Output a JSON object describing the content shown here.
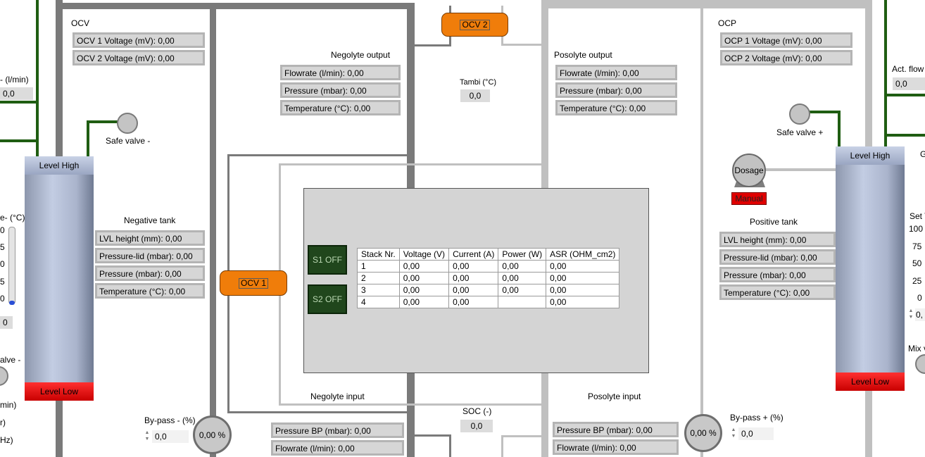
{
  "ocv_panel": {
    "title": "OCV",
    "ocv1": "OCV 1 Voltage (mV): 0,00",
    "ocv2": "OCV 2 Voltage (mV): 0,00"
  },
  "ocp_panel": {
    "title": "OCP",
    "ocp1": "OCP 1 Voltage (mV): 0,00",
    "ocp2": "OCP 2 Voltage (mV): 0,00"
  },
  "negolyte_output": {
    "title": "Negolyte output",
    "flowrate": "Flowrate (l/min): 0,00",
    "pressure": "Pressure (mbar): 0,00",
    "temperature": "Temperature (°C): 0,00"
  },
  "posolyte_output": {
    "title": "Posolyte output",
    "flowrate": "Flowrate (l/min): 0,00",
    "pressure": "Pressure (mbar): 0,00",
    "temperature": "Temperature (°C): 0,00"
  },
  "negative_tank": {
    "title": "Negative tank",
    "lvl": "LVL height (mm): 0,00",
    "pressure_lid": "Pressure-lid (mbar): 0,00",
    "pressure": "Pressure (mbar): 0,00",
    "temperature": "Temperature (°C): 0,00",
    "level_high": "Level High",
    "level_low": "Level Low"
  },
  "positive_tank": {
    "title": "Positive tank",
    "lvl": "LVL height (mm): 0,00",
    "pressure_lid": "Pressure-lid (mbar): 0,00",
    "pressure": "Pressure (mbar): 0,00",
    "temperature": "Temperature (°C): 0,00",
    "level_high": "Level High",
    "level_low": "Level Low"
  },
  "valves": {
    "safe_neg": "Safe valve -",
    "safe_pos": "Safe valve +"
  },
  "ocv_buttons": {
    "ocv1": "OCV 1",
    "ocv2": "OCV 2"
  },
  "tambi": {
    "label": "Tambi (°C)",
    "value": "0,0"
  },
  "soc": {
    "label": "SOC (-)",
    "value": "0,0"
  },
  "negolyte_input": {
    "title": "Negolyte input",
    "pressure_bp": "Pressure BP (mbar): 0,00",
    "flowrate": "Flowrate (l/min): 0,00"
  },
  "posolyte_input": {
    "title": "Posolyte input",
    "pressure_bp": "Pressure BP (mbar): 0,00",
    "flowrate": "Flowrate (l/min): 0,00"
  },
  "bypass_neg": {
    "label": "By-pass - (%)",
    "value": "0,0",
    "gauge": "0,00 %"
  },
  "bypass_pos": {
    "label": "By-pass + (%)",
    "value": "0,0",
    "gauge": "0,00 %"
  },
  "dosage": {
    "label": "Dosage",
    "mode": "Manual"
  },
  "stack": {
    "buttons": [
      "S1 OFF",
      "S2 OFF"
    ],
    "headers": [
      "Stack Nr.",
      "Voltage (V)",
      "Current (A)",
      "Power (W)",
      "ASR (OHM_cm2)"
    ],
    "rows": [
      [
        "1",
        "0,00",
        "0,00",
        "0,00",
        "0,00"
      ],
      [
        "2",
        "0,00",
        "0,00",
        "0,00",
        "0,00"
      ],
      [
        "3",
        "0,00",
        "0,00",
        "0,00",
        "0,00"
      ],
      [
        "4",
        "0,00",
        "0,00",
        "",
        "0,00"
      ]
    ]
  },
  "left_edge": {
    "flow_label": "- (l/min)",
    "flow_value": "0,0",
    "temp_label": "e- (°C)",
    "temp_ticks": [
      "0",
      "5",
      "0",
      "5",
      "0"
    ],
    "temp_value": "0",
    "valve_label": "alve -",
    "misc": [
      "min)",
      "r)",
      "Hz)"
    ]
  },
  "right_edge": {
    "act_flow_label": "Act. flow",
    "act_flow_value": "0,0",
    "g_label": "G",
    "set_label": "Set T",
    "set_ticks": [
      "100",
      "75",
      "50",
      "25",
      "0"
    ],
    "set_value": "0,",
    "mix_label": "Mix v"
  },
  "colors": {
    "pipe_dark": "#7a7a7a",
    "pipe_light": "#c0c0c0",
    "pipe_green": "#1f5d12",
    "orange": "#f07d0a",
    "alarm_red": "#e00000",
    "stack_btn": "#20461c"
  }
}
